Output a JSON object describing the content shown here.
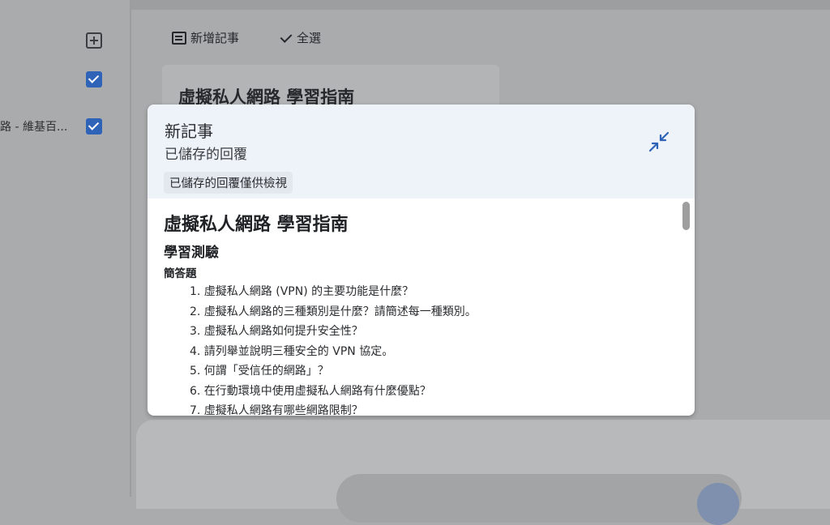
{
  "sidebar": {
    "source_label": "路 - 維基百...",
    "add_icon": "add-box-icon",
    "checkbox_icon": "checkbox-checked-icon"
  },
  "toolbar": {
    "add_note_label": "新增記事",
    "select_all_label": "全選"
  },
  "background_note": {
    "title": "虛擬私人網路 學習指南"
  },
  "modal": {
    "title": "新記事",
    "subtitle": "已儲存的回覆",
    "readonly_badge": "已儲存的回覆僅供檢視",
    "collapse_icon": "collapse-content-icon",
    "accent_color": "#2f63b8",
    "header_bg": "#eef3fa"
  },
  "document": {
    "title": "虛擬私人網路 學習指南",
    "section": "學習測驗",
    "subsection": "簡答題",
    "questions": [
      "1. 虛擬私人網路 (VPN) 的主要功能是什麼？",
      "2. 虛擬私人網路的三種類別是什麼？請簡述每一種類別。",
      "3. 虛擬私人網路如何提升安全性？",
      "4. 請列舉並說明三種安全的 VPN 協定。",
      "5. 何謂「受信任的網路」？",
      "6. 在行動環境中使用虛擬私人網路有什麼優點？",
      "7. 虛擬私人網路有哪些網路限制？"
    ]
  }
}
